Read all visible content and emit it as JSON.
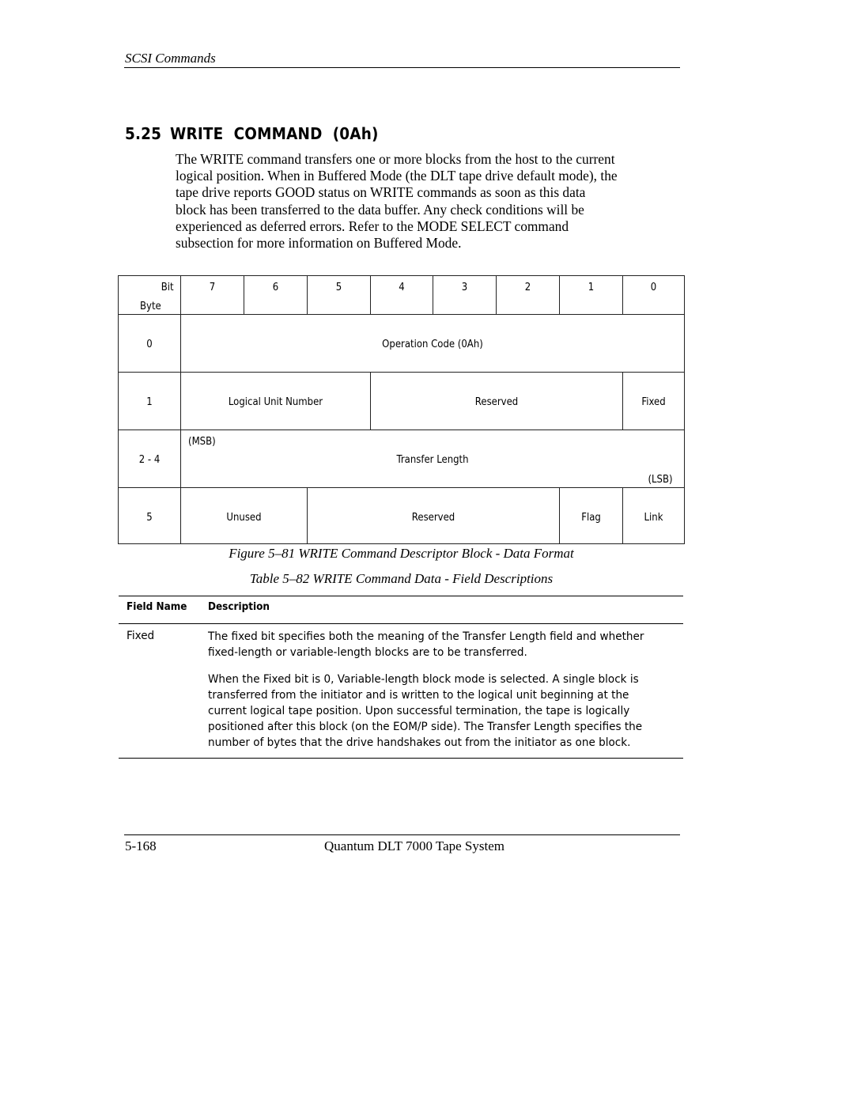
{
  "header": {
    "running_head": "SCSI Commands"
  },
  "section": {
    "number": "5.25",
    "title": "WRITE  COMMAND  (0Ah)"
  },
  "intro_lines": [
    "The WRITE command transfers one or more blocks from the host to the current",
    "logical position. When in Buffered Mode (the DLT tape drive default mode), the",
    "tape drive reports GOOD status on WRITE commands as soon as this data",
    "block has been transferred to the data buffer. Any check conditions will be",
    "experienced as deferred errors.  Refer to the MODE SELECT command",
    "subsection for more information on Buffered Mode."
  ],
  "cdb_table": {
    "bit_label": "Bit",
    "byte_label": "Byte",
    "bits": [
      "7",
      "6",
      "5",
      "4",
      "3",
      "2",
      "1",
      "0"
    ],
    "rows": [
      {
        "byte": "0",
        "fields": [
          {
            "label": "Operation Code (0Ah)",
            "bits": "7-0"
          }
        ]
      },
      {
        "byte": "1",
        "fields": [
          {
            "label": "Logical Unit Number",
            "bits": "7-5"
          },
          {
            "label": "Reserved",
            "bits": "4-1"
          },
          {
            "label": "Fixed",
            "bits": "0"
          }
        ]
      },
      {
        "byte": "2 - 4",
        "fields": [
          {
            "label": "Transfer Length",
            "bits": "7-0",
            "msb": "(MSB)",
            "lsb": "(LSB)"
          }
        ]
      },
      {
        "byte": "5",
        "fields": [
          {
            "label": "Unused",
            "bits": "7-6"
          },
          {
            "label": "Reserved",
            "bits": "5-2"
          },
          {
            "label": "Flag",
            "bits": "1"
          },
          {
            "label": "Link",
            "bits": "0"
          }
        ]
      }
    ]
  },
  "figure_caption": "Figure 5–81  WRITE Command Descriptor Block - Data Format",
  "table_caption": "Table 5–82  WRITE Command Data - Field Descriptions",
  "field_table": {
    "headers": [
      "Field Name",
      "Description"
    ],
    "rows": [
      {
        "name": "Fixed",
        "paragraphs": [
          [
            "The fixed bit specifies both the meaning of the Transfer Length field and whether",
            "fixed-length or variable-length blocks are to be transferred."
          ],
          [
            "When the Fixed bit is 0, Variable-length block mode is selected. A single block is",
            "transferred from the initiator and is written to the logical unit beginning at the",
            "current logical tape position. Upon successful termination, the tape is logically",
            "positioned after this block (on the EOM/P side). The Transfer Length specifies the",
            "number of bytes that the drive handshakes out from the initiator as one block."
          ]
        ]
      }
    ]
  },
  "footer": {
    "page_number": "5-168",
    "book_title": "Quantum DLT 7000 Tape System"
  }
}
